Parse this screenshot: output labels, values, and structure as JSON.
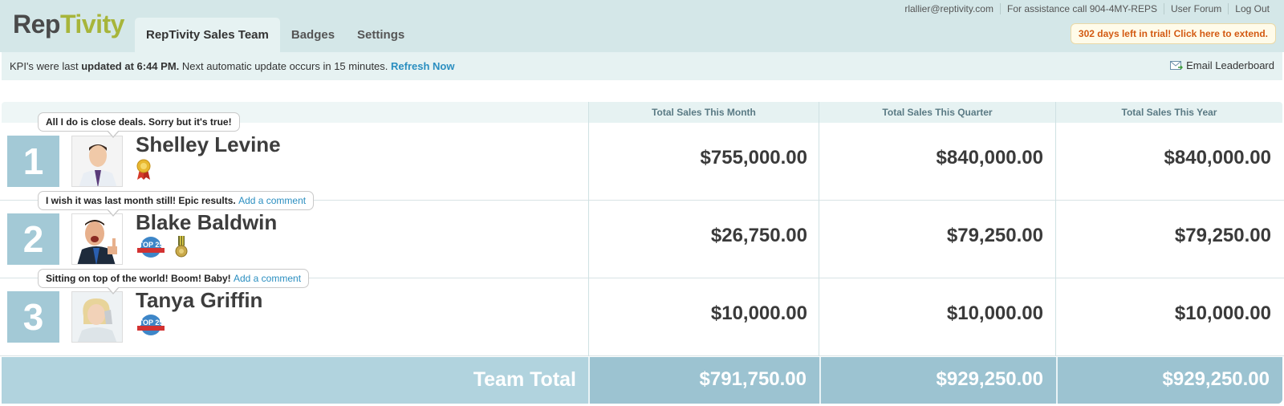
{
  "header": {
    "logo_part1": "Rep",
    "logo_part2": "Tivity",
    "tabs": [
      {
        "label": "RepTivity Sales Team",
        "active": true
      },
      {
        "label": "Badges",
        "active": false
      },
      {
        "label": "Settings",
        "active": false
      }
    ],
    "user_email": "rlallier@reptivity.com",
    "assistance": "For assistance call 904-4MY-REPS",
    "user_forum": "User Forum",
    "logout": "Log Out",
    "trial_notice": "302 days left in trial! Click here to extend."
  },
  "infobar": {
    "prefix": "KPI's were last ",
    "updated": "updated at 6:44 PM.",
    "suffix": " Next automatic update occurs in 15 minutes. ",
    "refresh": "Refresh Now",
    "email_leaderboard": "Email Leaderboard"
  },
  "table": {
    "columns": [
      "Total Sales This Month",
      "Total Sales This Quarter",
      "Total Sales This Year"
    ],
    "rows": [
      {
        "rank": "1",
        "name": "Shelley Levine",
        "comment": "All I do is close deals. Sorry but it's true!",
        "add_comment": "",
        "month": "$755,000.00",
        "quarter": "$840,000.00",
        "year": "$840,000.00"
      },
      {
        "rank": "2",
        "name": "Blake Baldwin",
        "comment": "I wish it was last month still! Epic results.",
        "add_comment": "Add a comment",
        "month": "$26,750.00",
        "quarter": "$79,250.00",
        "year": "$79,250.00"
      },
      {
        "rank": "3",
        "name": "Tanya Griffin",
        "comment": "Sitting on top of the world! Boom! Baby!",
        "add_comment": "Add a comment",
        "month": "$10,000.00",
        "quarter": "$10,000.00",
        "year": "$10,000.00"
      }
    ],
    "total": {
      "label": "Team Total",
      "month": "$791,750.00",
      "quarter": "$929,250.00",
      "year": "$929,250.00"
    }
  },
  "badges": {
    "top25": "TOP 25"
  },
  "colors": {
    "rank_bg": "#a3c9d6",
    "link": "#2a8ec0",
    "trial_text": "#d35a12",
    "logo_green": "#a7b53a"
  }
}
